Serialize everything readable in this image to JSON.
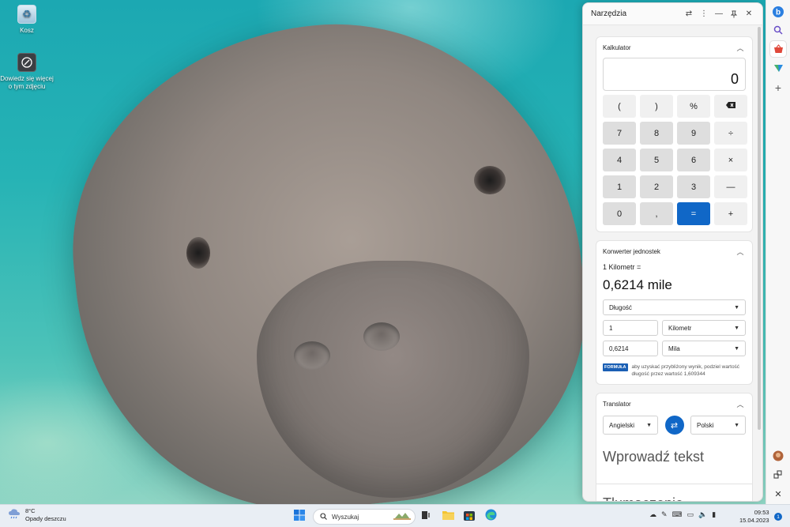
{
  "desktop": {
    "icons": [
      {
        "label": "Kosz",
        "icon": "recycle-bin-icon"
      },
      {
        "label": "Dowiedz się więcej o tym zdjęciu",
        "icon": "learn-about-picture-icon"
      }
    ]
  },
  "panel": {
    "title": "Narzędzia",
    "header_icons": [
      "sliders-icon",
      "more-icon",
      "minimize-icon",
      "pin-icon",
      "close-icon"
    ],
    "calculator": {
      "title": "Kalkulator",
      "display": "0",
      "keys": [
        "(",
        ")",
        "%",
        "⌫",
        "7",
        "8",
        "9",
        "÷",
        "4",
        "5",
        "6",
        "×",
        "1",
        "2",
        "3",
        "—",
        "0",
        ",",
        "=",
        "+"
      ]
    },
    "converter": {
      "title": "Konwerter jednostek",
      "label": "1 Kilometr =",
      "result": "0,6214 mile",
      "category": "Długość",
      "from_value": "1",
      "from_unit": "Kilometr",
      "to_value": "0,6214",
      "to_unit": "Mila",
      "formula_badge": "FORMUŁA",
      "formula_text": "aby uzyskać przybliżony wynik, podziel wartość długość przez wartość 1,609344"
    },
    "translator": {
      "title": "Translator",
      "source_lang": "Angielski",
      "target_lang": "Polski",
      "input_placeholder": "Wprowadź tekst",
      "output_placeholder": "Tłumaczenie"
    }
  },
  "sidebar": {
    "items": [
      "bing-chat-icon",
      "search-icon",
      "shopping-icon",
      "drop-icon",
      "add-icon",
      "profile-avatar-icon",
      "share-icon",
      "close-icon"
    ]
  },
  "taskbar": {
    "weather_temp": "8°C",
    "weather_desc": "Opady deszczu",
    "search_placeholder": "Wyszukaj",
    "time": "09:53",
    "date": "15.04.2023",
    "notifications": "1",
    "colors": {
      "accent": "#1067c7",
      "taskbar_bg": "#e9eef4"
    }
  }
}
